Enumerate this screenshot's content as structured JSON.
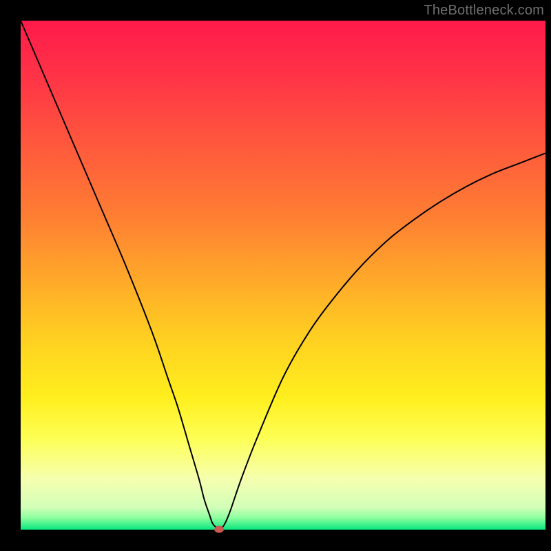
{
  "watermark": "TheBottleneck.com",
  "chart_data": {
    "type": "line",
    "title": "",
    "xlabel": "",
    "ylabel": "",
    "xlim": [
      0,
      100
    ],
    "ylim": [
      0,
      100
    ],
    "grid": false,
    "legend": false,
    "plot_background": {
      "type": "vertical_gradient",
      "stops": [
        {
          "offset": 0.0,
          "color": "#ff1a4b"
        },
        {
          "offset": 0.12,
          "color": "#ff3646"
        },
        {
          "offset": 0.25,
          "color": "#ff5a3c"
        },
        {
          "offset": 0.38,
          "color": "#ff7d33"
        },
        {
          "offset": 0.5,
          "color": "#ffa62a"
        },
        {
          "offset": 0.62,
          "color": "#ffcf21"
        },
        {
          "offset": 0.74,
          "color": "#ffef1e"
        },
        {
          "offset": 0.82,
          "color": "#fdff55"
        },
        {
          "offset": 0.9,
          "color": "#f6ffb0"
        },
        {
          "offset": 0.955,
          "color": "#d2ffb8"
        },
        {
          "offset": 0.975,
          "color": "#8effa0"
        },
        {
          "offset": 1.0,
          "color": "#00e57c"
        }
      ]
    },
    "frame_color": "#000000",
    "series": [
      {
        "name": "bottleneck-curve",
        "color": "#000000",
        "stroke_width": 2,
        "x": [
          0,
          5,
          10,
          15,
          20,
          25,
          28,
          30,
          32,
          34,
          35,
          36,
          36.5,
          37,
          37.5,
          37.8,
          38.2,
          39,
          40,
          42,
          45,
          50,
          55,
          60,
          65,
          70,
          75,
          80,
          85,
          90,
          95,
          100
        ],
        "y": [
          100,
          88,
          76,
          64,
          52,
          39,
          30,
          24,
          17,
          10,
          6,
          3,
          1.5,
          0.8,
          0.4,
          0.2,
          0.3,
          1.5,
          4,
          10,
          18,
          30,
          39,
          46,
          52,
          57,
          61,
          64.5,
          67.5,
          70,
          72,
          74
        ]
      }
    ],
    "marker": {
      "name": "optimal-point",
      "x": 37.8,
      "y": 0.2,
      "rx": 0.9,
      "ry": 0.7,
      "color": "#cc5a52"
    }
  }
}
